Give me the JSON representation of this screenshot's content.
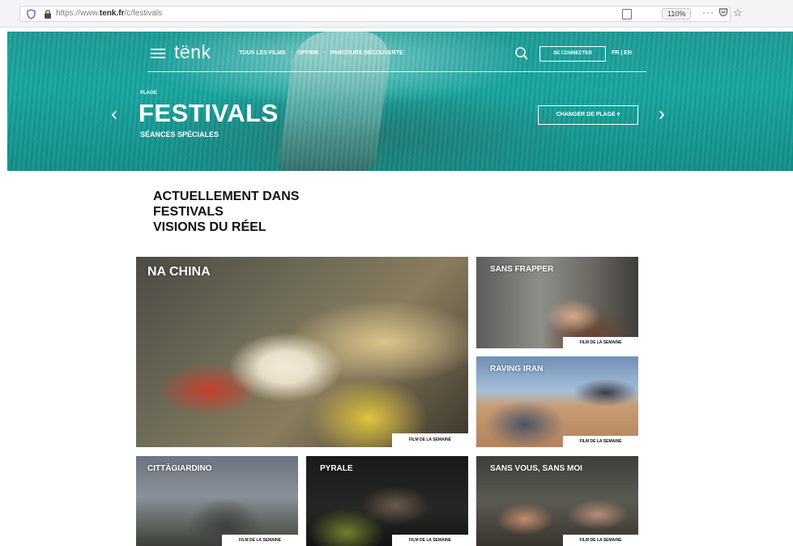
{
  "browser": {
    "url_prefix": "https://www.",
    "url_domain": "tenk.fr",
    "url_path": "/c/festivals",
    "zoom": "110%"
  },
  "header": {
    "logo": "tënk",
    "nav_links": [
      "TOUS LES FILMS",
      "OFFRIR",
      "PARCOURS DÉCOUVERTE"
    ],
    "separator": "·",
    "connect_label": "SE CONNECTER",
    "lang_label": "FR | EN"
  },
  "hero": {
    "plage_label": "PLAGE",
    "title": "FESTIVALS",
    "subtitle": "SÉANCES SPÉCIALES",
    "change_button": "CHANGER DE PLAGE ▾",
    "prev": "‹",
    "next": "›"
  },
  "section": {
    "heading_lines": [
      "ACTUELLEMENT DANS",
      "FESTIVALS",
      "VISIONS DU RÉEL"
    ]
  },
  "films": [
    {
      "title": "NA CHINA",
      "badge": "FILM DE LA SEMAINE"
    },
    {
      "title": "SANS FRAPPER",
      "badge": "FILM DE LA SEMAINE"
    },
    {
      "title": "RAVING IRAN",
      "badge": "FILM DE LA SEMAINE"
    },
    {
      "title": "CITTÀGIARDINO",
      "badge": "FILM DE LA SEMAINE"
    },
    {
      "title": "PYRALE",
      "badge": "FILM DE LA SEMAINE"
    },
    {
      "title": "SANS VOUS, SANS MOI",
      "badge": "FILM DE LA SEMAINE"
    }
  ],
  "colors": {
    "hero_teal": "#19a6a0",
    "text_dark": "#111111"
  },
  "icons": [
    "shield-icon",
    "lock-icon",
    "reader-icon",
    "more-icon",
    "pocket-icon",
    "bookmark-star-icon",
    "hamburger-icon",
    "search-icon",
    "chevron-left-icon",
    "chevron-right-icon"
  ]
}
